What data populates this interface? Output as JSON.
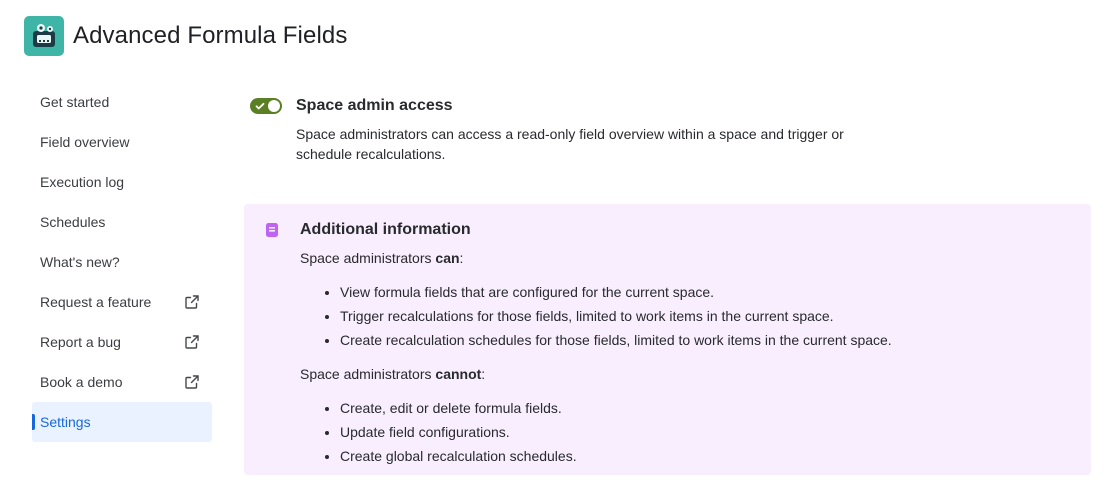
{
  "app": {
    "title": "Advanced Formula Fields"
  },
  "sidebar": {
    "items": [
      {
        "label": "Get started",
        "external": false
      },
      {
        "label": "Field overview",
        "external": false
      },
      {
        "label": "Execution log",
        "external": false
      },
      {
        "label": "Schedules",
        "external": false
      },
      {
        "label": "What's new?",
        "external": false
      },
      {
        "label": "Request a feature",
        "external": true
      },
      {
        "label": "Report a bug",
        "external": true
      },
      {
        "label": "Book a demo",
        "external": true
      },
      {
        "label": "Settings",
        "external": false,
        "active": true
      }
    ]
  },
  "settings": {
    "toggle_title": "Space admin access",
    "toggle_enabled": true,
    "toggle_desc": "Space administrators can access a read-only field overview within a space and trigger or schedule recalculations."
  },
  "info": {
    "title": "Additional information",
    "can_prefix": "Space administrators ",
    "can_bold": "can",
    "can_suffix": ":",
    "can_items": [
      "View formula fields that are configured for the current space.",
      "Trigger recalculations for those fields, limited to work items in the current space.",
      "Create recalculation schedules for those fields, limited to work items in the current space."
    ],
    "cannot_prefix": "Space administrators ",
    "cannot_bold": "cannot",
    "cannot_suffix": ":",
    "cannot_items": [
      "Create, edit or delete formula fields.",
      "Update field configurations.",
      "Create global recalculation schedules."
    ]
  },
  "colors": {
    "toggle_on": "#5b7f24",
    "active_nav": "#1868db",
    "info_bg": "#f8eefe",
    "info_icon": "#bf63f3",
    "logo_bg": "#3fb5a8"
  }
}
